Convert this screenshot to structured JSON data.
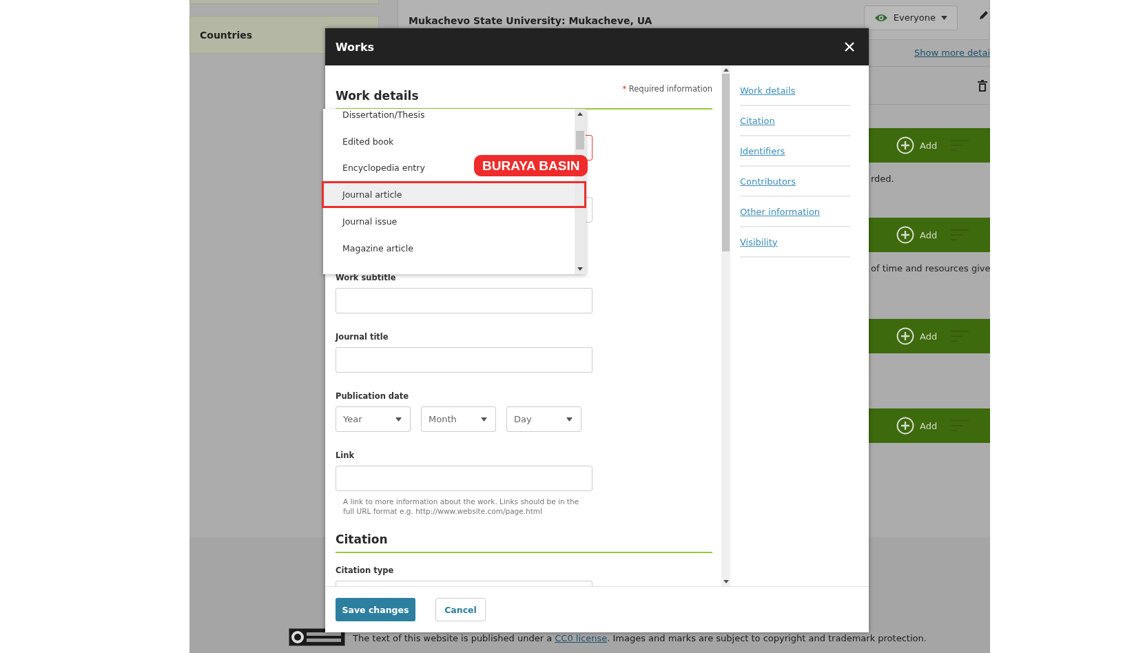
{
  "sidebar": {
    "items": [
      {
        "label": "Countries"
      }
    ]
  },
  "affiliation": {
    "title": "Mukachevo State University: Mukacheve, UA",
    "visibility": "Everyone",
    "more_link": "Show more detai"
  },
  "sections": [
    {
      "action": "Add",
      "note": "rded."
    },
    {
      "action": "Add",
      "note": "of time and resources give"
    },
    {
      "action": "Add"
    },
    {
      "action": "Add"
    }
  ],
  "footer": {
    "before": "The text of this website is published under a ",
    "link": "CC0 license",
    "after": ". Images and marks are subject to copyright and trademark protection."
  },
  "dialog": {
    "title": "Works",
    "heading": "Work details",
    "required_mark": "*",
    "required_note": "Required information",
    "fields": [
      {
        "kind": "text",
        "label": "Work subtitle"
      },
      {
        "kind": "text",
        "label": "Journal title"
      },
      {
        "kind": "date",
        "label": "Publication date",
        "parts": [
          "Year",
          "Month",
          "Day"
        ]
      },
      {
        "kind": "text",
        "label": "Link",
        "help": "A link to more information about the work. Links should be in the full URL format e.g. http://www.website.com/page.html"
      }
    ],
    "citation_heading": "Citation",
    "citation_label": "Citation type",
    "nav": [
      {
        "label": "Work details"
      },
      {
        "label": "Citation"
      },
      {
        "label": "Identifiers"
      },
      {
        "label": "Contributors"
      },
      {
        "label": "Other information"
      },
      {
        "label": "Visibility"
      }
    ],
    "save": "Save changes",
    "cancel": "Cancel"
  },
  "dropdown": {
    "options": [
      {
        "label": "Dissertation/Thesis",
        "selected": false
      },
      {
        "label": "Edited book",
        "selected": false
      },
      {
        "label": "Encyclopedia entry",
        "selected": false
      },
      {
        "label": "Journal article",
        "selected": true
      },
      {
        "label": "Journal issue",
        "selected": false
      },
      {
        "label": "Magazine article",
        "selected": false
      }
    ]
  },
  "callout": {
    "label": "BURAYA BASIN"
  }
}
